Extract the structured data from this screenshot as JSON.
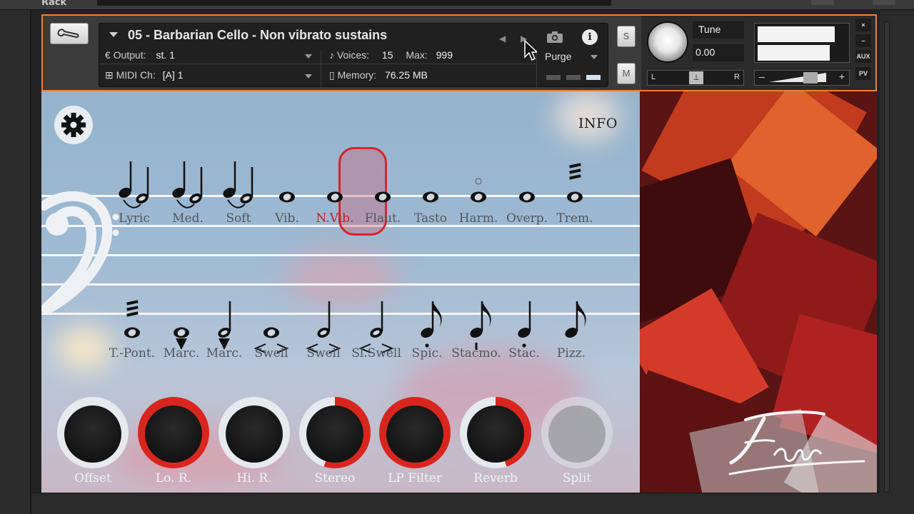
{
  "rack": {
    "label": "Rack"
  },
  "header": {
    "instrument_name": "05 - Barbarian Cello - Non vibrato sustains",
    "output_label": "Output:",
    "output_value": "st. 1",
    "midi_label": "MIDI Ch:",
    "midi_value": "[A]  1",
    "voices_label": "Voices:",
    "voices_value": "15",
    "max_label": "Max:",
    "max_value": "999",
    "memory_label": "Memory:",
    "memory_value": "76.25 MB",
    "purge_label": "Purge",
    "solo_label": "S",
    "mute_label": "M",
    "tune_label": "Tune",
    "tune_value": "0.00",
    "pan_left": "L",
    "pan_right": "R",
    "vol_minus": "–",
    "vol_plus": "+",
    "aux_label": "AUX",
    "pv_label": "PV",
    "close_label": "×",
    "minimize_label": "–",
    "meter_levels": [
      0.86,
      0.8
    ]
  },
  "main": {
    "info_label": "INFO",
    "articulations_row1": [
      {
        "label": "Lyric",
        "selected": false
      },
      {
        "label": "Med.",
        "selected": false
      },
      {
        "label": "Soft",
        "selected": false
      },
      {
        "label": "Vib.",
        "selected": false
      },
      {
        "label": "N.Vib.",
        "selected": true
      },
      {
        "label": "Flaut.",
        "selected": false
      },
      {
        "label": "Tasto",
        "selected": false
      },
      {
        "label": "Harm.",
        "selected": false
      },
      {
        "label": "Overp.",
        "selected": false
      },
      {
        "label": "Trem.",
        "selected": false
      }
    ],
    "articulations_row2": [
      {
        "label": "T.-Pont."
      },
      {
        "label": "Marc."
      },
      {
        "label": "Marc."
      },
      {
        "label": "Swell"
      },
      {
        "label": "Swell"
      },
      {
        "label": "Sl.Swell"
      },
      {
        "label": "Spic."
      },
      {
        "label": "Stacmo."
      },
      {
        "label": "Stac."
      },
      {
        "label": "Pizz."
      }
    ],
    "knobs": [
      {
        "label": "Offset",
        "value": 0.0,
        "enabled": true
      },
      {
        "label": "Lo. R.",
        "value": 1.0,
        "enabled": true
      },
      {
        "label": "Hi. R.",
        "value": 0.0,
        "enabled": true
      },
      {
        "label": "Stereo",
        "value": 0.55,
        "enabled": true
      },
      {
        "label": "LP Filter",
        "value": 1.0,
        "enabled": true
      },
      {
        "label": "Reverb",
        "value": 0.45,
        "enabled": true
      },
      {
        "label": "Split",
        "value": 0.0,
        "enabled": false
      }
    ]
  },
  "colors": {
    "accent": "#e8823a",
    "selection": "#d2262b",
    "knob_active": "#d8261f",
    "knob_inactive": "#e6e9ee"
  }
}
